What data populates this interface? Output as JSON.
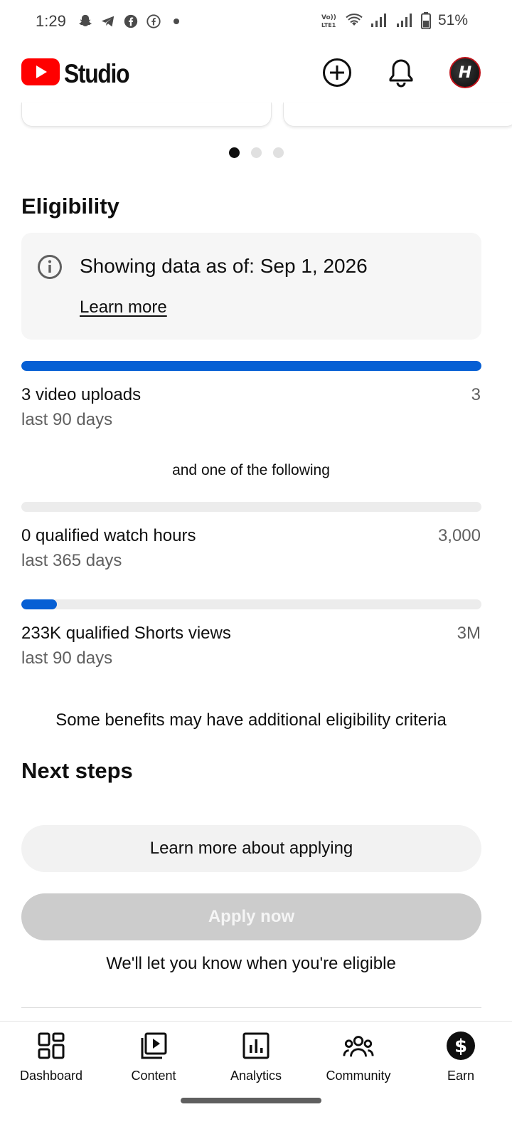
{
  "status_bar": {
    "time": "1:29",
    "notification_icons": [
      "snapchat-icon",
      "telegram-icon",
      "facebook-icon",
      "facebook-outline-icon",
      "dot-icon"
    ],
    "right_icons": [
      "volte-icon",
      "wifi-icon",
      "signal-1-icon",
      "signal-2-icon",
      "battery-icon"
    ],
    "network_label": "Vo)) LTE1",
    "battery": "51%"
  },
  "app_bar": {
    "title": "Studio",
    "brand_color": "#ff0000",
    "actions": [
      "create-icon",
      "notifications-icon",
      "avatar"
    ]
  },
  "carousel": {
    "page_count": 3,
    "active_index": 0
  },
  "eligibility": {
    "title": "Eligibility",
    "info_text": "Showing data as of: Sep 1, 2026",
    "learn_more": "Learn more",
    "requirements": [
      {
        "label": "3 video uploads",
        "sub": "last 90 days",
        "target": "3",
        "progress": 1.0
      },
      {
        "label": "0 qualified watch hours",
        "sub": "last 365 days",
        "target": "3,000",
        "progress": 0.0
      },
      {
        "label": "233K qualified Shorts views",
        "sub": "last 90 days",
        "target": "3M",
        "progress": 0.078
      }
    ],
    "separator_text": "and one of the following",
    "note": "Some benefits may have additional eligibility criteria",
    "accent_color": "#065fd4"
  },
  "next_steps": {
    "title": "Next steps",
    "learn_more_button": "Learn more about applying",
    "apply_button": "Apply now",
    "apply_enabled": false,
    "footer_text": "We'll let you know when you're eligible"
  },
  "bottom_nav": {
    "items": [
      {
        "label": "Dashboard",
        "icon": "dashboard-icon"
      },
      {
        "label": "Content",
        "icon": "content-icon"
      },
      {
        "label": "Analytics",
        "icon": "analytics-icon"
      },
      {
        "label": "Community",
        "icon": "community-icon"
      },
      {
        "label": "Earn",
        "icon": "earn-icon",
        "active": true
      }
    ]
  }
}
